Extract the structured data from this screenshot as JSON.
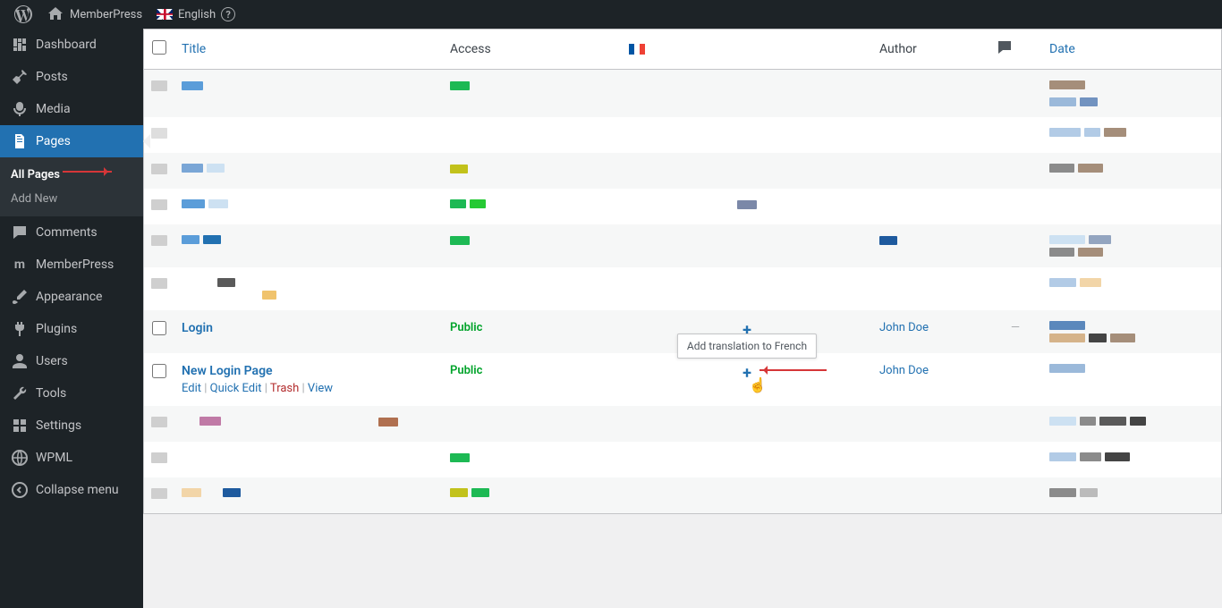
{
  "adminbar": {
    "site_name": "MemberPress",
    "language": "English"
  },
  "sidebar": {
    "items": [
      {
        "label": "Dashboard"
      },
      {
        "label": "Posts"
      },
      {
        "label": "Media"
      },
      {
        "label": "Pages"
      },
      {
        "label": "Comments"
      },
      {
        "label": "MemberPress"
      },
      {
        "label": "Appearance"
      },
      {
        "label": "Plugins"
      },
      {
        "label": "Users"
      },
      {
        "label": "Tools"
      },
      {
        "label": "Settings"
      },
      {
        "label": "WPML"
      },
      {
        "label": "Collapse menu"
      }
    ],
    "submenu": {
      "all_pages": "All Pages",
      "add_new": "Add New"
    }
  },
  "table": {
    "headers": {
      "title": "Title",
      "access": "Access",
      "author": "Author",
      "date": "Date"
    }
  },
  "rows": {
    "login": {
      "title": "Login",
      "access": "Public",
      "author": "John Doe",
      "comments": "—"
    },
    "newlogin": {
      "title": "New Login Page",
      "access": "Public",
      "author": "John Doe",
      "actions": {
        "edit": "Edit",
        "quick": "Quick Edit",
        "trash": "Trash",
        "view": "View"
      }
    }
  },
  "tooltip": {
    "text": "Add translation to French"
  }
}
